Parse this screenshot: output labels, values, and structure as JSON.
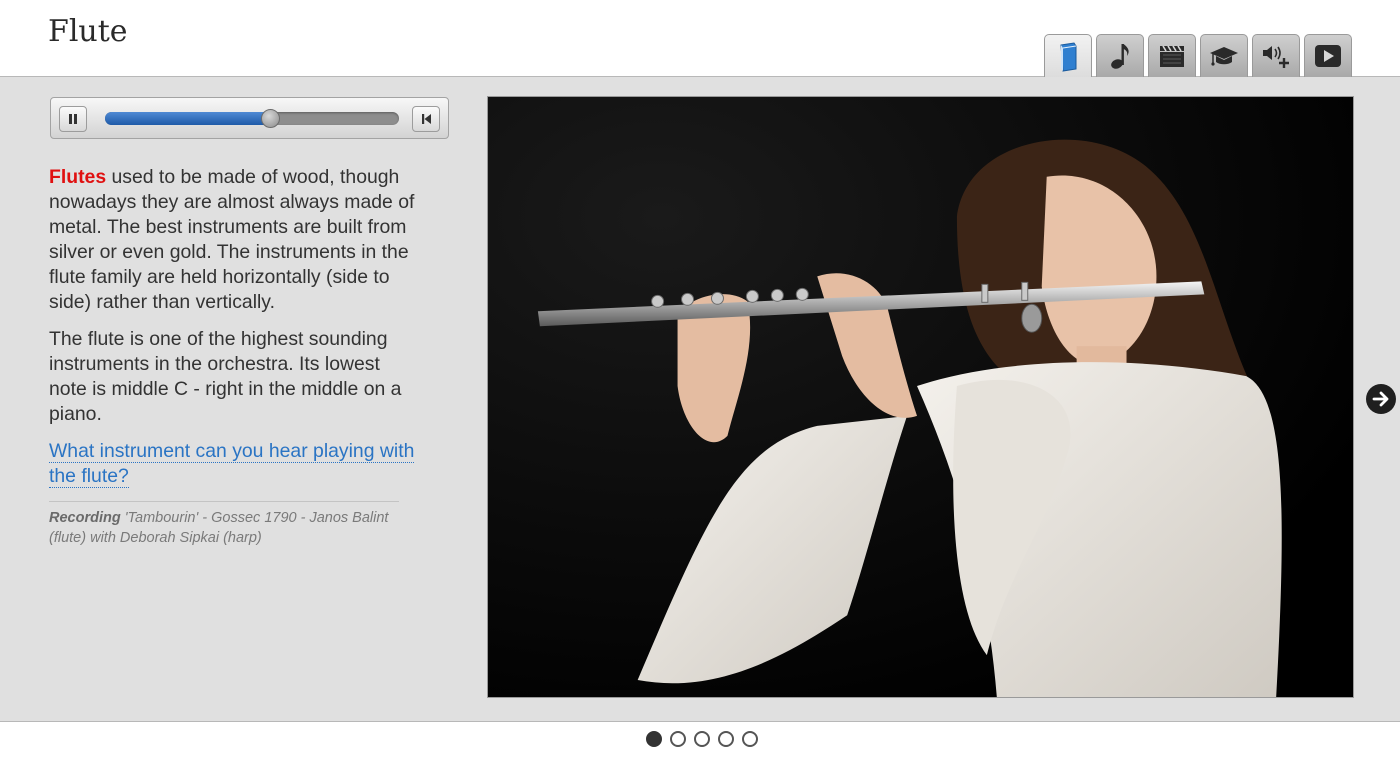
{
  "header": {
    "title": "Flute",
    "tabs": [
      {
        "icon": "book-icon",
        "active": true
      },
      {
        "icon": "music-note-icon",
        "active": false
      },
      {
        "icon": "clapperboard-icon",
        "active": false
      },
      {
        "icon": "graduation-cap-icon",
        "active": false
      },
      {
        "icon": "volume-plus-icon",
        "active": false
      },
      {
        "icon": "play-icon",
        "active": false
      }
    ]
  },
  "player": {
    "progress": 0.56,
    "accent": "#2a6cc0"
  },
  "article": {
    "highlight": "Flutes",
    "para1_rest": " used to be made of wood, though nowadays they are almost always made of metal. The best instruments are built from silver or even gold. The instruments in the flute family are held horizontally (side to side) rather than vertically.",
    "para2": "The flute is one of the highest sounding instruments in the orchestra. Its lowest note is middle C - right in the middle on a piano.",
    "question_link": "What instrument can you hear playing with the flute?",
    "caption_label": "Recording",
    "caption_text": " 'Tambourin' - Gossec 1790 - Janos Balint (flute) with Deborah Sipkai (harp)"
  },
  "colors": {
    "highlight": "#e01010",
    "link": "#2a74c4",
    "panel_bg": "#e0e0e0"
  },
  "pagination": {
    "total": 5,
    "current": 1
  }
}
